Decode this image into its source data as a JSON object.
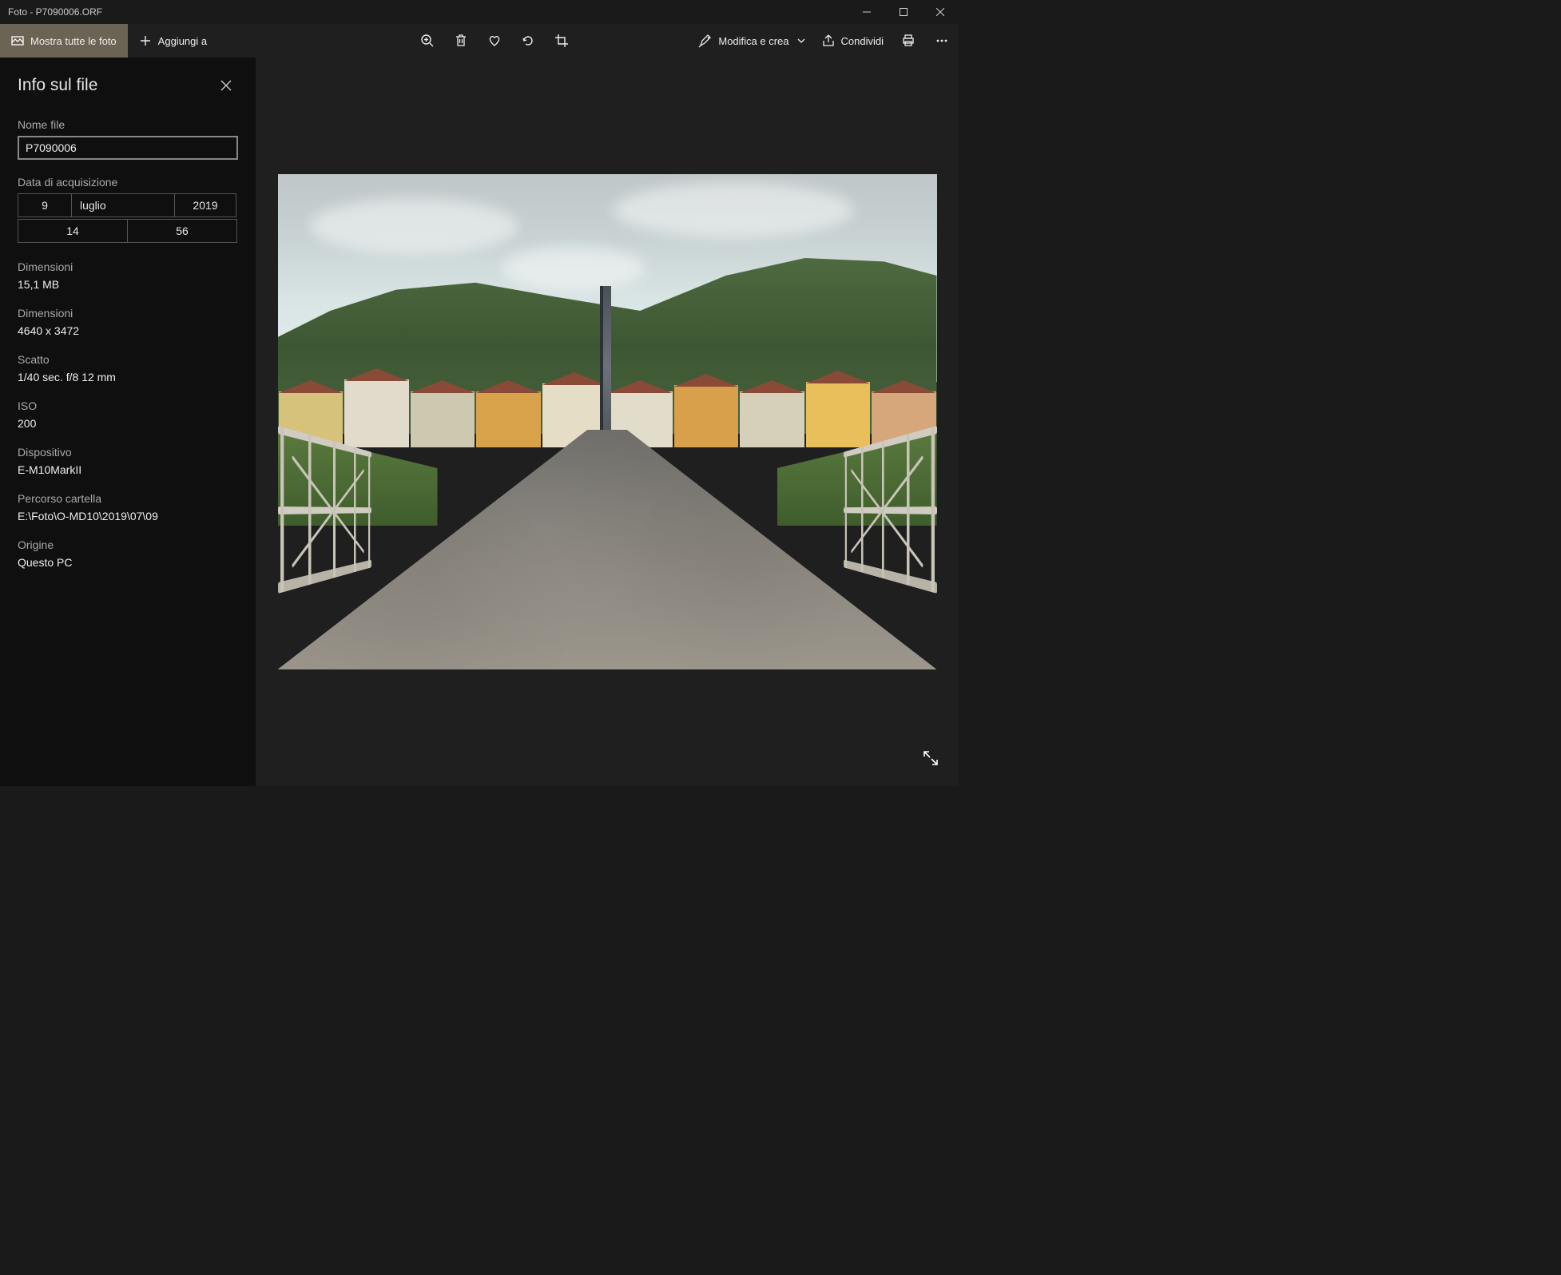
{
  "titlebar": {
    "title": "Foto - P7090006.ORF"
  },
  "commandbar": {
    "show_all": "Mostra tutte le foto",
    "add_to": "Aggiungi a",
    "edit_create": "Modifica e crea",
    "share": "Condividi"
  },
  "panel": {
    "title": "Info sul file",
    "filename_label": "Nome file",
    "filename_value": "P7090006",
    "date_label": "Data di acquisizione",
    "date": {
      "day": "9",
      "month": "luglio",
      "year": "2019",
      "hour": "14",
      "minute": "56"
    },
    "size_label": "Dimensioni",
    "size_value": "15,1 MB",
    "dims_label": "Dimensioni",
    "dims_value": "4640 x 3472",
    "shot_label": "Scatto",
    "shot_value": "1/40 sec. f/8 12 mm",
    "iso_label": "ISO",
    "iso_value": "200",
    "device_label": "Dispositivo",
    "device_value": "E-M10MarkII",
    "folder_label": "Percorso cartella",
    "folder_value": "E:\\Foto\\O-MD10\\2019\\07\\09",
    "origin_label": "Origine",
    "origin_value": "Questo PC"
  }
}
